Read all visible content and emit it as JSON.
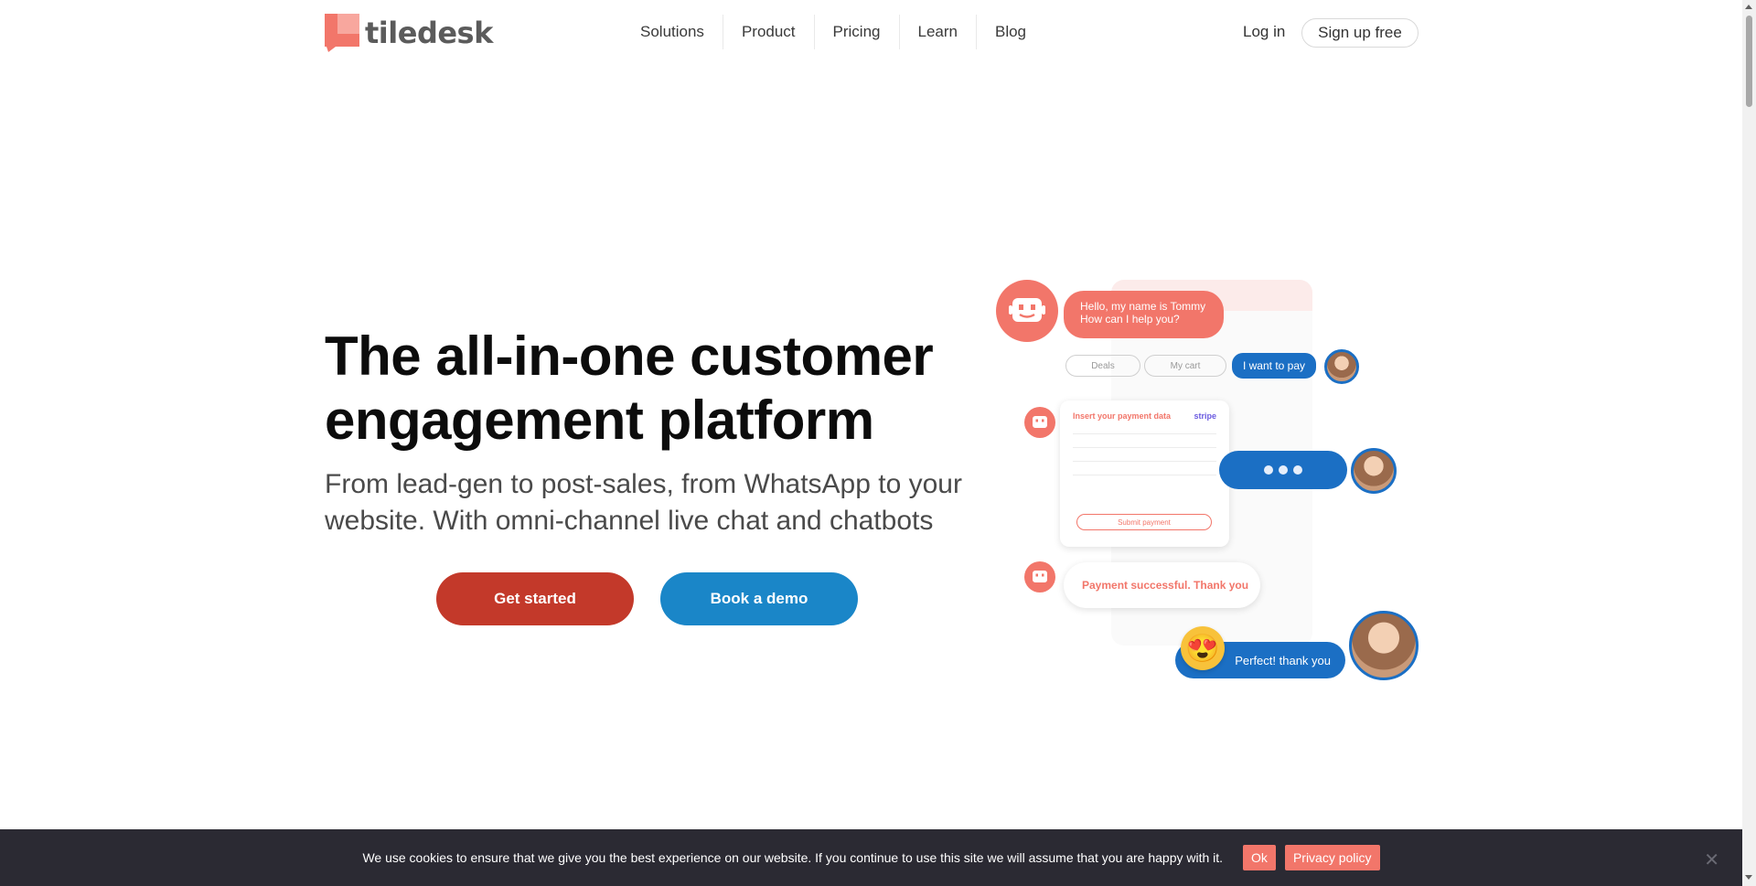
{
  "brand": {
    "name": "tiledesk",
    "logo_color": "#f2766a"
  },
  "nav": {
    "items": [
      {
        "label": "Solutions"
      },
      {
        "label": "Product"
      },
      {
        "label": "Pricing"
      },
      {
        "label": "Learn"
      },
      {
        "label": "Blog"
      }
    ],
    "login_label": "Log in",
    "signup_label": "Sign up free"
  },
  "hero": {
    "title": "The all-in-one customer engagement platform",
    "subtitle": "From lead-gen to post-sales, from WhatsApp to your website. With omni-channel live chat and chatbots",
    "primary_cta": "Get started",
    "secondary_cta": "Book a demo",
    "primary_color": "#c3392a",
    "secondary_color": "#1a86c8"
  },
  "illustration": {
    "bot_greeting": "Hello, my name is Tommy How can I help you?",
    "chips": [
      "Deals",
      "My cart",
      "I want to pay"
    ],
    "payment_card": {
      "title": "Insert your payment data",
      "provider": "stripe",
      "submit_label": "Submit payment"
    },
    "payment_success": "Payment successful. Thank you",
    "user_reply": "Perfect! thank you",
    "emoji": "😍"
  },
  "cookie_bar": {
    "message": "We use cookies to ensure that we give you the best experience on our website. If you continue to use this site we will assume that you are happy with it.",
    "ok_label": "Ok",
    "privacy_label": "Privacy policy",
    "close_symbol": "✕"
  }
}
